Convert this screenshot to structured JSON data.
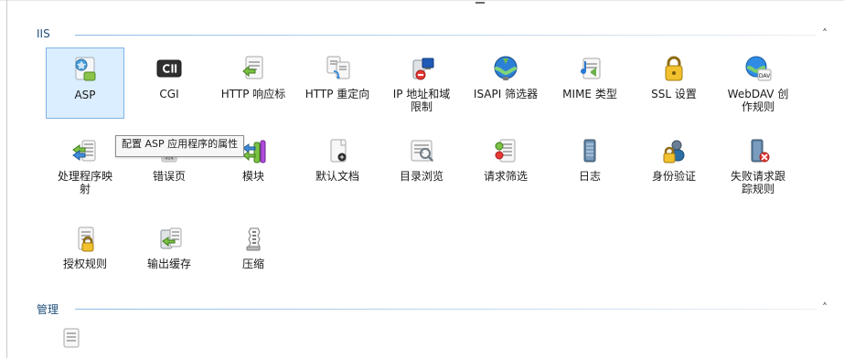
{
  "sections": {
    "iis": {
      "title": "IIS",
      "items": [
        {
          "label": "ASP",
          "icon": "asp-icon",
          "selected": true
        },
        {
          "label": "CGI",
          "icon": "cgi-icon"
        },
        {
          "label": "HTTP 响应标",
          "icon": "http-response-header-icon"
        },
        {
          "label": "HTTP 重定向",
          "icon": "http-redirect-icon"
        },
        {
          "label": "IP 地址和域\n限制",
          "icon": "ip-domain-restrictions-icon"
        },
        {
          "label": "ISAPI 筛选器",
          "icon": "isapi-filter-icon"
        },
        {
          "label": "MIME 类型",
          "icon": "mime-types-icon"
        },
        {
          "label": "SSL 设置",
          "icon": "ssl-settings-icon"
        },
        {
          "label": "WebDAV 创\n作规则",
          "icon": "webdav-authoring-rules-icon"
        },
        {
          "label": "处理程序映\n射",
          "icon": "handler-mappings-icon"
        },
        {
          "label": "错误页",
          "icon": "error-pages-icon"
        },
        {
          "label": "模块",
          "icon": "modules-icon"
        },
        {
          "label": "默认文档",
          "icon": "default-document-icon"
        },
        {
          "label": "目录浏览",
          "icon": "directory-browsing-icon"
        },
        {
          "label": "请求筛选",
          "icon": "request-filtering-icon"
        },
        {
          "label": "日志",
          "icon": "logging-icon"
        },
        {
          "label": "身份验证",
          "icon": "authentication-icon"
        },
        {
          "label": "失败请求跟\n踪规则",
          "icon": "failed-request-tracing-rules-icon"
        },
        {
          "label": "授权规则",
          "icon": "authorization-rules-icon"
        },
        {
          "label": "输出缓存",
          "icon": "output-caching-icon"
        },
        {
          "label": "压缩",
          "icon": "compression-icon"
        }
      ]
    },
    "management": {
      "title": "管理"
    }
  },
  "tooltip": {
    "text": "配置 ASP 应用程序的属性"
  },
  "colors": {
    "section_title": "#1f4e79",
    "selected_bg": "#dbeeff",
    "selected_border": "#7fb3e6"
  }
}
